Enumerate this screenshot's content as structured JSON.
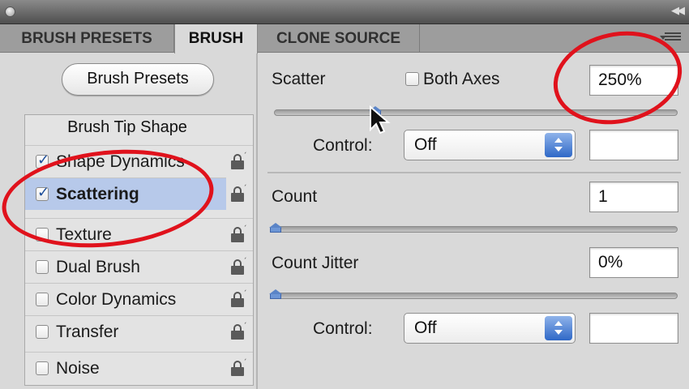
{
  "tabs": [
    {
      "label": "BRUSH PRESETS",
      "active": false
    },
    {
      "label": "BRUSH",
      "active": true
    },
    {
      "label": "CLONE SOURCE",
      "active": false
    }
  ],
  "left": {
    "preset_button": "Brush Presets",
    "list_heading": "Brush Tip Shape",
    "items": [
      {
        "label": "Shape Dynamics",
        "checked": true,
        "selected": false,
        "locked": true
      },
      {
        "label": "Scattering",
        "checked": true,
        "selected": true,
        "locked": true
      },
      {
        "label": "Texture",
        "checked": false,
        "selected": false,
        "locked": true
      },
      {
        "label": "Dual Brush",
        "checked": false,
        "selected": false,
        "locked": true
      },
      {
        "label": "Color Dynamics",
        "checked": false,
        "selected": false,
        "locked": true
      },
      {
        "label": "Transfer",
        "checked": false,
        "selected": false,
        "locked": true
      },
      {
        "label": "Noise",
        "checked": false,
        "selected": false,
        "locked": true
      }
    ]
  },
  "scatter": {
    "label": "Scatter",
    "both_axes_label": "Both Axes",
    "both_axes_checked": false,
    "value": "250%",
    "slider_fraction": 0.25,
    "control_label": "Control:",
    "control_value": "Off",
    "control_extra": ""
  },
  "count": {
    "label": "Count",
    "value": "1",
    "slider_fraction": 0.0
  },
  "count_jitter": {
    "label": "Count Jitter",
    "value": "0%",
    "slider_fraction": 0.0,
    "control_label": "Control:",
    "control_value": "Off",
    "control_extra": ""
  },
  "colors": {
    "annotation": "#e0121c",
    "selection": "#b7c9ea",
    "stepper": "#2f68c7"
  }
}
